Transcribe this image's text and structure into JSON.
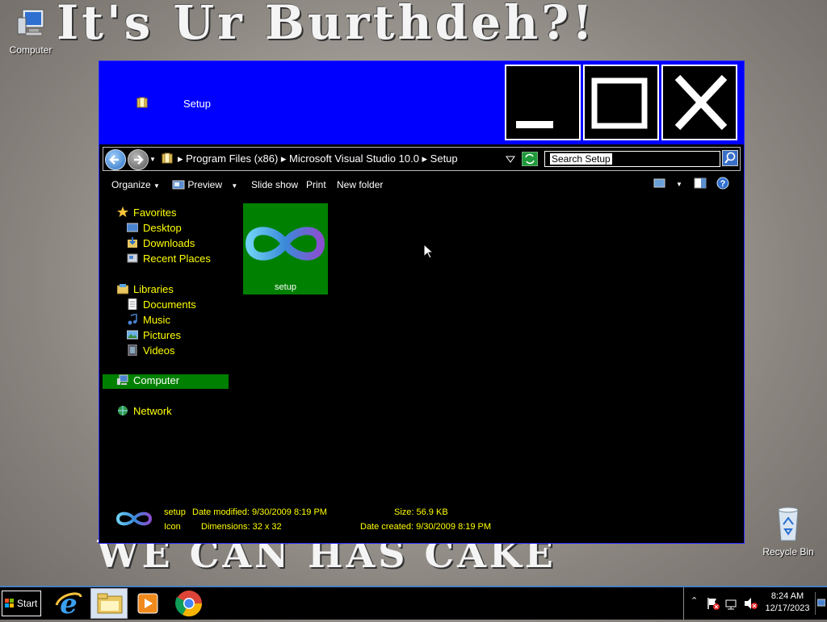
{
  "wallpaper": {
    "top_text": "It's Ur Burthdeh?!",
    "bottom_text": "WE CAN HAS CAKE"
  },
  "desktop": {
    "computer_label": "Computer",
    "recycle_label": "Recycle Bin"
  },
  "window": {
    "title": "Setup",
    "address_path": "▸ Program Files (x86) ▸ Microsoft Visual Studio 10.0 ▸ Setup",
    "search_placeholder": "Search Setup",
    "toolbar": {
      "organize": "Organize",
      "preview": "Preview",
      "slideshow": "Slide show",
      "print": "Print",
      "new_folder": "New folder"
    },
    "nav": {
      "favorites": "Favorites",
      "desktop": "Desktop",
      "downloads": "Downloads",
      "recent": "Recent Places",
      "libraries": "Libraries",
      "documents": "Documents",
      "music": "Music",
      "pictures": "Pictures",
      "videos": "Videos",
      "computer": "Computer",
      "network": "Network"
    },
    "file": {
      "name": "setup"
    },
    "details": {
      "name": "setup",
      "type": "Icon",
      "date_modified": "Date modified: 9/30/2009 8:19 PM",
      "dimensions": "Dimensions: 32 x 32",
      "size": "Size: 56.9 KB",
      "date_created": "Date created: 9/30/2009 8:19 PM"
    }
  },
  "taskbar": {
    "start_label": "Start",
    "time": "8:24 AM",
    "date": "12/17/2023"
  },
  "colors": {
    "titlebar": "#0000ff",
    "selection": "#008000",
    "nav_text": "#ffff00"
  }
}
